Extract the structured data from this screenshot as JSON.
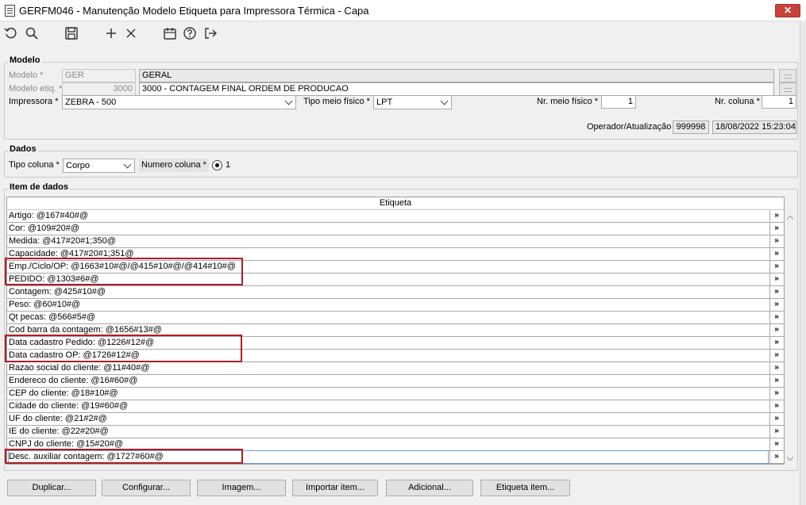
{
  "window": {
    "title": "GERFM046 - Manutenção Modelo Etiqueta para Impressora Térmica - Capa",
    "close_label": "✕"
  },
  "toolbar": {
    "icons": [
      "refresh-icon",
      "search-icon",
      "save-icon",
      "add-icon",
      "delete-icon",
      "calendar-icon",
      "help-icon",
      "exit-icon"
    ]
  },
  "modelo": {
    "group_title": "Modelo",
    "modelo_label": "Modelo *",
    "modelo_value": "GER",
    "modelo_desc": "GERAL",
    "modelo_etiq_label": "Modelo etiq. *",
    "modelo_etiq_value": "3000",
    "modelo_etiq_desc": "3000 - CONTAGEM FINAL ORDEM DE PRODUCAO",
    "impressora_label": "Impressora *",
    "impressora_value": "ZEBRA - 500",
    "tipo_meio_label": "Tipo meio físico *",
    "tipo_meio_value": "LPT",
    "nr_meio_label": "Nr. meio físico *",
    "nr_meio_value": "1",
    "nr_coluna_label": "Nr. coluna *",
    "nr_coluna_value": "1",
    "operador_label": "Operador/Atualização",
    "operador_value": "999998",
    "atualizacao_value": "18/08/2022 15:23:04"
  },
  "dados": {
    "group_title": "Dados",
    "tipo_coluna_label": "Tipo coluna *",
    "tipo_coluna_value": "Corpo",
    "numero_coluna_label": "Numero coluna *",
    "numero_coluna_option": "1"
  },
  "item_dados": {
    "group_title": "Item de dados",
    "column_header": "Etiqueta",
    "row_button": "»",
    "rows": [
      "Artigo: @167#40#@",
      "Cor: @109#20#@",
      "Medida: @417#20#1;350@",
      "Capacidade: @417#20#1;351@",
      "Emp./Ciclo/OP: @1663#10#@/@415#10#@/@414#10#@",
      "PEDIDO: @1303#6#@",
      "Contagem: @425#10#@",
      "Peso: @60#10#@",
      "Qt pecas: @566#5#@",
      "Cod barra da contagem: @1656#13#@",
      "Data cadastro Pedido: @1226#12#@",
      "Data cadastro OP: @1726#12#@",
      "Razao social do cliente: @11#40#@",
      "Endereco do cliente: @16#60#@",
      "CEP do cliente: @18#10#@",
      "Cidade do cliente: @19#60#@",
      "UF do cliente: @21#2#@",
      "IE do cliente: @22#20#@",
      "CNPJ do cliente: @15#20#@",
      "Desc. auxiliar contagem: @1727#60#@"
    ]
  },
  "buttons": {
    "duplicar": "Duplicar...",
    "configurar": "Configurar...",
    "imagem": "Imagem...",
    "importar": "Importar item...",
    "adicional": "Adicional...",
    "etiqueta_item": "Etiqueta item..."
  }
}
